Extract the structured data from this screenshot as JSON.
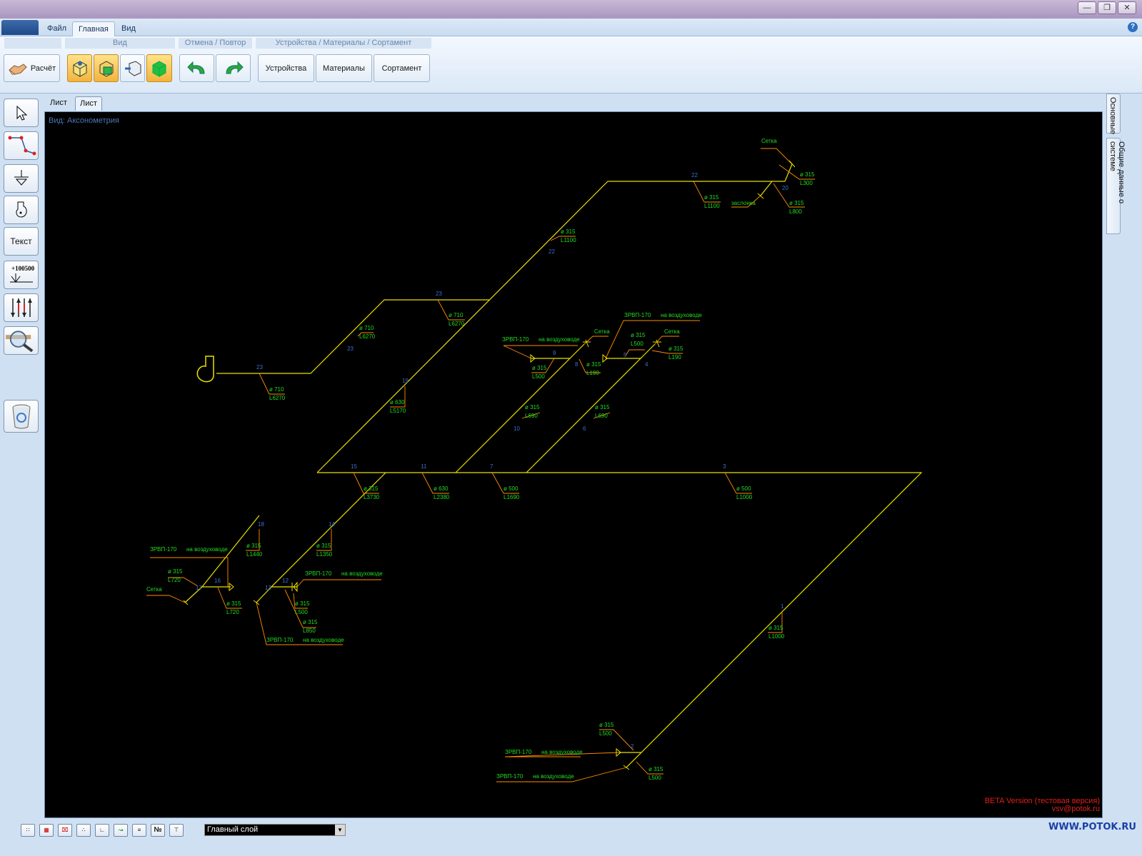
{
  "ribbon": {
    "tabs": [
      "Файл",
      "Главная",
      "Вид"
    ],
    "groups": {
      "view": "Вид",
      "undo_redo": "Отмена / Повтор",
      "devices": "Устройства / Материалы / Сортамент"
    },
    "calc_label": "Расчёт",
    "devices_label": "Устройства",
    "materials_label": "Материалы",
    "assortment_label": "Сортамент"
  },
  "toolbar": {
    "text_label": "Текст",
    "level_label": "+100500"
  },
  "sheet_tabs": [
    "Лист",
    "Лист"
  ],
  "canvas": {
    "view_label": "Вид: Аксонометрия",
    "beta_line1": "BETA Version (тестовая версия)",
    "beta_line2": "vsv@potok.ru"
  },
  "right_panel": [
    "Основные",
    "Общие данные о системе"
  ],
  "statusbar": {
    "layer": "Главный слой",
    "site": "WWW.POTOK.RU",
    "btn_labels": [
      "",
      "",
      "",
      "",
      "",
      "",
      "",
      "№",
      ""
    ]
  },
  "drawing": {
    "nodes": [
      "22",
      "20",
      "22",
      "23",
      "23",
      "23",
      "19",
      "9",
      "8",
      "5",
      "4",
      "10",
      "6",
      "15",
      "11",
      "7",
      "3",
      "18",
      "14",
      "17",
      "16",
      "13",
      "12",
      "1",
      "2"
    ],
    "diam_labels": [
      "ø 315",
      "ø 315",
      "ø 315",
      "ø 315",
      "ø 710",
      "ø 710",
      "ø 710",
      "ø 630",
      "ø 315",
      "ø 315",
      "ø 315",
      "ø 315",
      "ø 315",
      "ø 315",
      "ø 315",
      "ø 630",
      "ø 500",
      "ø 500",
      "ø 315",
      "ø 315",
      "ø 315",
      "ø 315",
      "ø 315",
      "ø 315",
      "ø 315",
      "ø 315",
      "ø 315",
      "ø 315",
      "ø 315"
    ],
    "len_labels": [
      "L1100",
      "L300",
      "L800",
      "L1100",
      "L6270",
      "L6270",
      "L6270",
      "L5170",
      "L500",
      "L190",
      "L500",
      "L190",
      "L690",
      "L690",
      "L3730",
      "L2380",
      "L1690",
      "L1000",
      "L1440",
      "L1350",
      "L720",
      "L720",
      "L500",
      "L850",
      "L1000",
      "L500",
      "L500"
    ],
    "device_labels": [
      "Сетка",
      "заслонка",
      "ЗРВП-170",
      "на воздуховоде",
      "Сетка",
      "ЗРВП-170",
      "на воздуховоде",
      "Сетка",
      "ЗРВП-170",
      "на воздуховоде",
      "Сетка",
      "ЗРВП-170",
      "на воздуховоде",
      "ЗРВП-170",
      "на воздуховоде",
      "ЗРВП-170",
      "на воздуховоде",
      "ЗРВП-170",
      "на воздуховоде"
    ]
  },
  "colors": {
    "duct": "#e8e000",
    "leader": "#ff8c00",
    "label_green": "#22dd22",
    "node_blue": "#3d6fd0",
    "canvas_bg": "#000000"
  }
}
